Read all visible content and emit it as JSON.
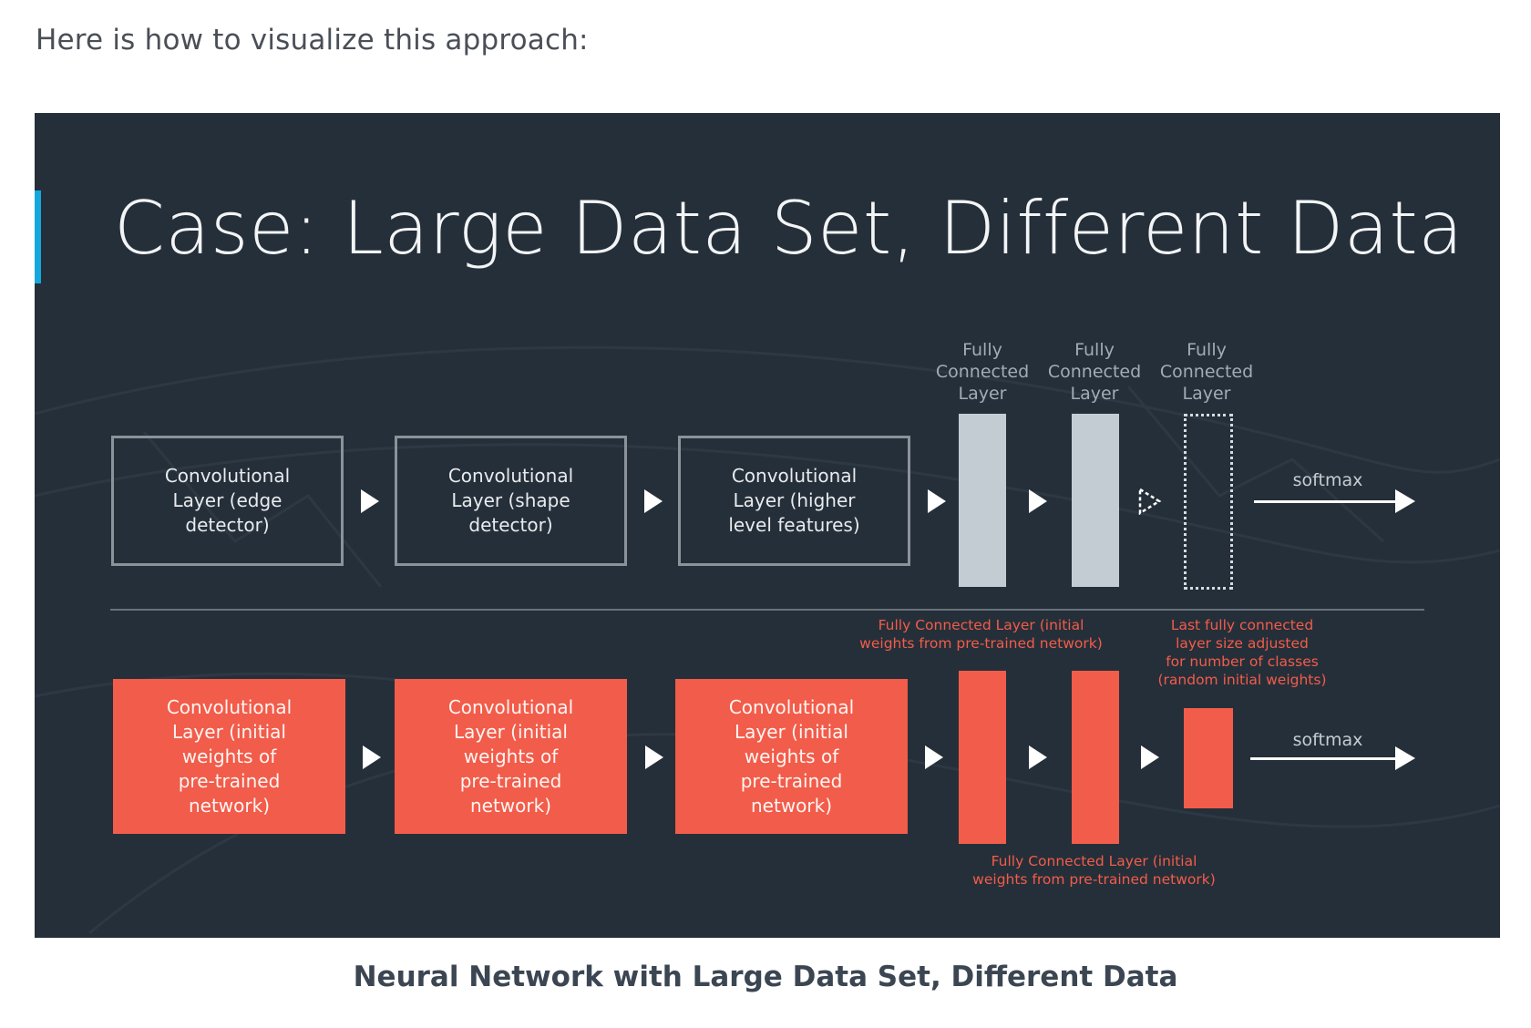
{
  "intro_text": "Here is how to visualize this approach:",
  "slide": {
    "title": "Case: Large Data Set, Different Data",
    "top_row": {
      "conv_boxes": [
        "Convolutional\nLayer (edge\ndetector)",
        "Convolutional\nLayer (shape\ndetector)",
        "Convolutional\nLayer (higher\nlevel features)"
      ],
      "fc_labels": [
        "Fully\nConnected\nLayer",
        "Fully\nConnected\nLayer",
        "Fully\nConnected\nLayer"
      ],
      "softmax_label": "softmax"
    },
    "bottom_row": {
      "conv_boxes": [
        "Convolutional\nLayer (initial\nweights of\npre-trained\nnetwork)",
        "Convolutional\nLayer (initial\nweights of\npre-trained\nnetwork)",
        "Convolutional\nLayer (initial\nweights of\npre-trained\nnetwork)"
      ],
      "note_fc_first": "Fully Connected Layer (initial\nweights from pre-trained network)",
      "note_fc_second": "Fully Connected Layer (initial\nweights from pre-trained network)",
      "note_last_fc": "Last fully connected\nlayer size adjusted\nfor number of classes\n(random initial weights)",
      "softmax_label": "softmax"
    },
    "colors": {
      "background": "#252f39",
      "accent": "#14a8de",
      "red": "#f25c4a",
      "grey_bar": "#c3ccd3"
    }
  },
  "caption": "Neural Network with Large Data Set, Different Data"
}
